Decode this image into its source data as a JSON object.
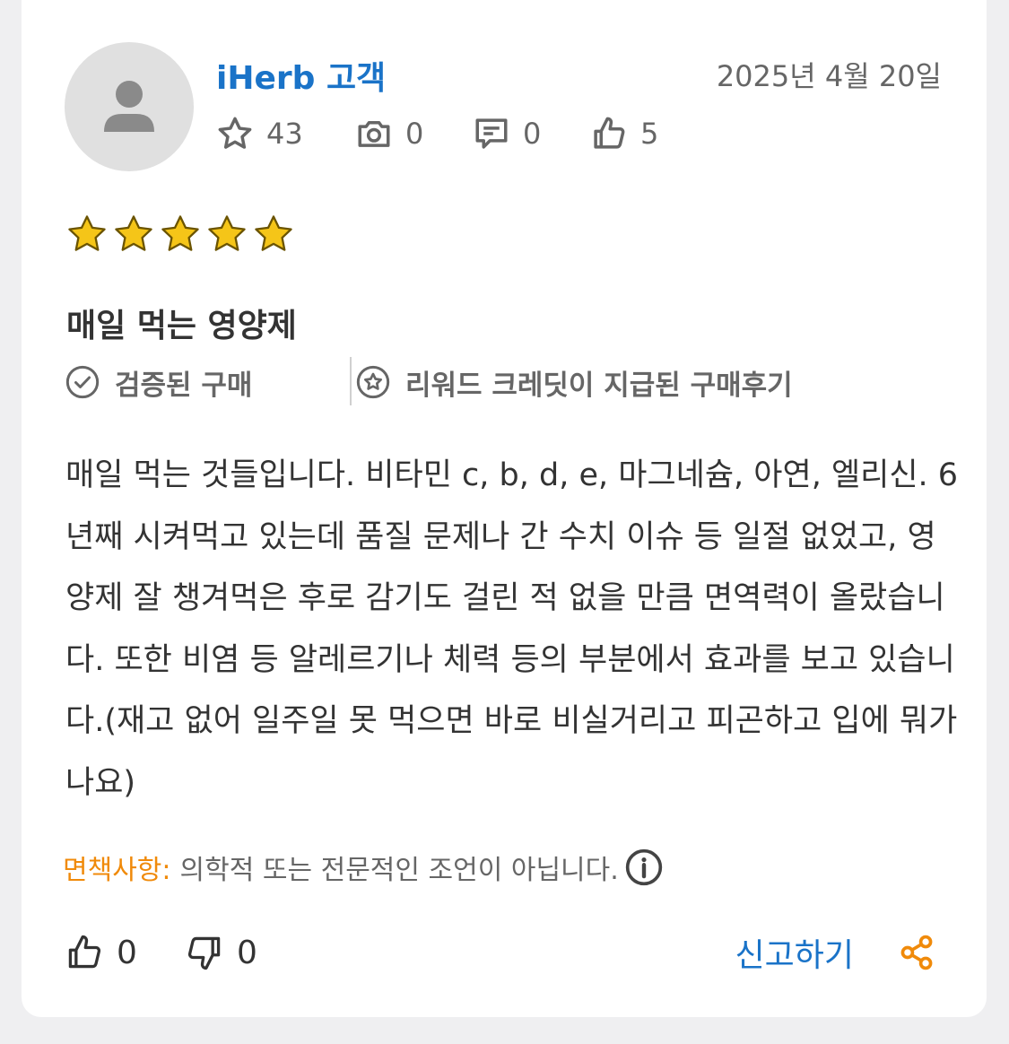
{
  "review": {
    "username": "iHerb 고객",
    "date": "2025년 4월 20일",
    "stats": {
      "points": "43",
      "photos": "0",
      "comments": "0",
      "helpful": "5"
    },
    "rating": 5,
    "rating_max": 5,
    "title": "매일 먹는 영양제",
    "badges": {
      "verified": "검증된 구매",
      "rewards": "리워드 크레딧이 지급된 구매후기"
    },
    "body": "매일 먹는 것들입니다. 비타민 c, b, d, e, 마그네슘, 아연, 엘리신. 6년째 시켜먹고 있는데 품질 문제나 간 수치 이슈 등 일절 없었고, 영양제 잘 챙겨먹은 후로 감기도 걸린 적 없을 만큼 면역력이 올랐습니다. 또한 비염 등 알레르기나 체력 등의 부분에서 효과를 보고 있습니다.(재고 없어 일주일 못 먹으면 바로 비실거리고 피곤하고 입에 뭐가 나요)",
    "disclaimer_label": "면책사항:",
    "disclaimer_text": "의학적 또는 전문적인 조언이 아닙니다."
  },
  "actions": {
    "like_count": "0",
    "dislike_count": "0",
    "report_label": "신고하기"
  },
  "colors": {
    "accent_blue": "#1a73c8",
    "disclaimer_orange": "#f08a0a",
    "star_gold": "#f5c518"
  },
  "icons": [
    "user-icon",
    "star-outline-icon",
    "camera-icon",
    "comment-icon",
    "thumbs-up-icon",
    "star-filled-icon",
    "check-circle-icon",
    "star-circle-icon",
    "info-icon",
    "thumbs-down-icon",
    "share-icon"
  ]
}
